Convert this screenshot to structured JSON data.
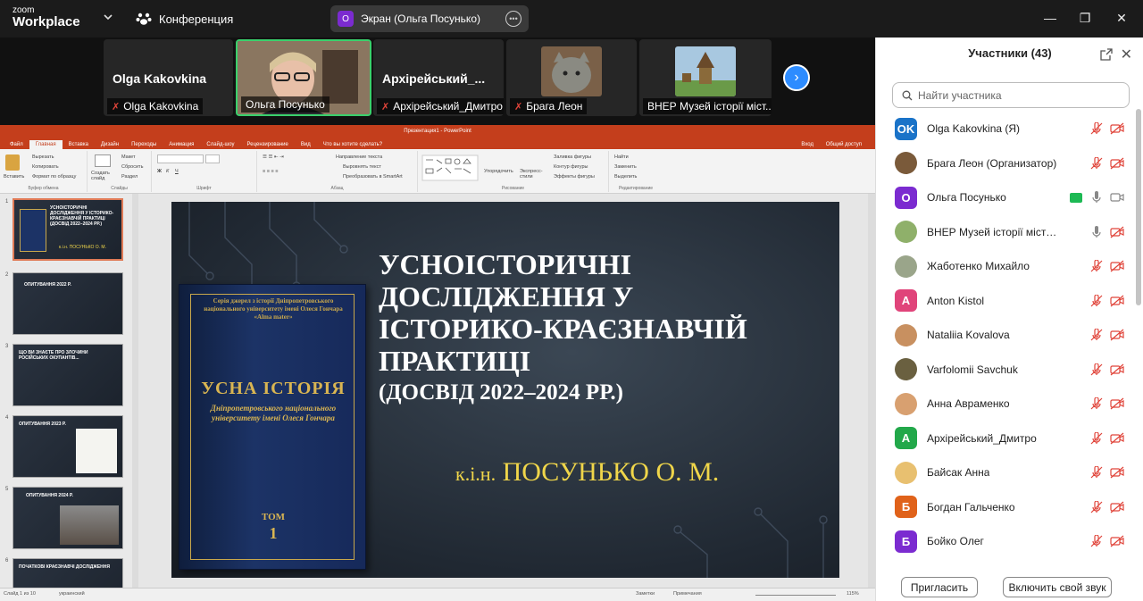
{
  "topbar": {
    "logo_small": "zoom",
    "logo_big": "Workplace",
    "meeting_label": "Конференция",
    "share_initial": "О",
    "share_label": "Экран (Ольга Посунько)"
  },
  "strip": {
    "tiles": [
      {
        "big_name": "Olga Kakovkina",
        "caption": "Olga Kakovkina",
        "muted": true
      },
      {
        "caption": "Ольга Посунько",
        "muted": false
      },
      {
        "big_name": "Архірейський_...",
        "caption": "Архірейський_Дмитро",
        "muted": true
      },
      {
        "caption": "Брага Леон",
        "muted": true
      },
      {
        "caption": "ВНЕР Музей історії міст...",
        "muted": false
      }
    ]
  },
  "ppt": {
    "window_title": "Презентация1 - PowerPoint",
    "tabs": [
      "Файл",
      "Главная",
      "Вставка",
      "Дизайн",
      "Переходы",
      "Анимация",
      "Слайд-шоу",
      "Рецензирование",
      "Вид",
      "Что вы хотите сделать?"
    ],
    "login": "Вход",
    "share": "Общий доступ",
    "ribbon": {
      "paste": "Вставить",
      "cut": "Вырезать",
      "copy": "Копировать",
      "format_painter": "Формат по образцу",
      "clipboard": "Буфер обмена",
      "new_slide": "Создать слайд",
      "layout": "Макет",
      "reset": "Сбросить",
      "section": "Раздел",
      "slides": "Слайды",
      "font": "Шрифт",
      "paragraph": "Абзац",
      "text_direction": "Направление текста",
      "align_text": "Выровнять текст",
      "smartart": "Преобразовать в SmartArt",
      "arrange": "Упорядочить",
      "quick_styles": "Экспресс-стили",
      "shape_fill": "Заливка фигуры",
      "shape_outline": "Контур фигуры",
      "shape_effects": "Эффекты фигуры",
      "drawing": "Рисование",
      "find": "Найти",
      "replace": "Заменить",
      "select": "Выделить",
      "editing": "Редактирование"
    },
    "thumbs": [
      {
        "num": "1",
        "title": "УСНОІСТОРИЧНІ ДОСЛІДЖЕННЯ У ІСТОРИКО-КРАЄЗНАВЧІЙ ПРАКТИЦІ (ДОСВІД 2022–2024 РР.)",
        "author": "к.і.н. ПОСУНЬКО О. М."
      },
      {
        "num": "2",
        "title": "ОПИТУВАННЯ 2022 Р."
      },
      {
        "num": "3",
        "title": "ЩО ВИ ЗНАЄТЕ ПРО ЗЛОЧИНИ РОСІЙСЬКИХ ОКУПАНТІВ..."
      },
      {
        "num": "4",
        "title": "ОПИТУВАННЯ 2023 Р."
      },
      {
        "num": "5",
        "title": "ОПИТУВАННЯ 2024 Р."
      },
      {
        "num": "6",
        "title": "ПОЧАТКОВІ КРАЄЗНАВЧІ ДОСЛІДЖЕННЯ"
      }
    ],
    "status_left": "Слайд 1 из 10",
    "status_lang": "украинский",
    "status_notes": "Заметки",
    "status_comments": "Примечания",
    "zoom": "115%"
  },
  "slide": {
    "title_lines": [
      "УСНОІСТОРИЧНІ",
      "ДОСЛІДЖЕННЯ У",
      "ІСТОРИКО-КРАЄЗНАВЧІЙ",
      "ПРАКТИЦІ"
    ],
    "subtitle": "(ДОСВІД 2022–2024 РР.)",
    "author_prefix": "к.і.н.",
    "author_name": "ПОСУНЬКО О. М.",
    "book": {
      "series": "Серія джерел з історії Дніпропетровського національного університету імені Олеся Гончара «Alma mater»",
      "title": "УСНА ІСТОРІЯ",
      "subtitle": "Дніпропетровського національного університету імені Олеся Гончара",
      "tom": "ТОМ",
      "num": "1"
    }
  },
  "panel": {
    "title": "Участники (43)",
    "search_placeholder": "Найти участника",
    "participants": [
      {
        "name": "Olga Kakovkina (Я)",
        "initials": "OK",
        "color": "#1a73c8",
        "mic": "muted",
        "cam": "off"
      },
      {
        "name": "Брага Леон (Организатор)",
        "initials": "",
        "color": "#7a5a3a",
        "mic": "muted",
        "cam": "off"
      },
      {
        "name": "Ольга Посунько",
        "initials": "О",
        "color": "#7b2bd0",
        "mic": "on",
        "cam": "on",
        "sharing": true
      },
      {
        "name": "ВНЕР Музей історії міста Кам'...",
        "initials": "",
        "color": "#8fb06a",
        "mic": "on",
        "cam": "off"
      },
      {
        "name": "Жаботенко Михайло",
        "initials": "",
        "color": "#9aa58a",
        "mic": "muted",
        "cam": "off"
      },
      {
        "name": "Anton Kistol",
        "initials": "A",
        "color": "#e0447a",
        "mic": "muted",
        "cam": "off"
      },
      {
        "name": "Nataliia Kovalova",
        "initials": "",
        "color": "#c89060",
        "mic": "muted",
        "cam": "off"
      },
      {
        "name": "Varfolomii Savchuk",
        "initials": "",
        "color": "#6a6040",
        "mic": "muted",
        "cam": "off"
      },
      {
        "name": "Анна Авраменко",
        "initials": "",
        "color": "#d8a070",
        "mic": "muted",
        "cam": "off"
      },
      {
        "name": "Архірейський_Дмитро",
        "initials": "А",
        "color": "#22a84a",
        "mic": "muted",
        "cam": "off"
      },
      {
        "name": "Байсак Анна",
        "initials": "",
        "color": "#e8c070",
        "mic": "muted",
        "cam": "off"
      },
      {
        "name": "Богдан Гальченко",
        "initials": "Б",
        "color": "#e0621a",
        "mic": "muted",
        "cam": "off"
      },
      {
        "name": "Бойко Олег",
        "initials": "Б",
        "color": "#7b2bd0",
        "mic": "muted",
        "cam": "off"
      }
    ],
    "invite_button": "Пригласить",
    "unmute_button": "Включить свой звук"
  },
  "colors": {
    "zoom_blue": "#2d8cff",
    "ppt_orange": "#c43e1c",
    "muted_red": "#e0443a",
    "active_green": "#3ad06c"
  }
}
